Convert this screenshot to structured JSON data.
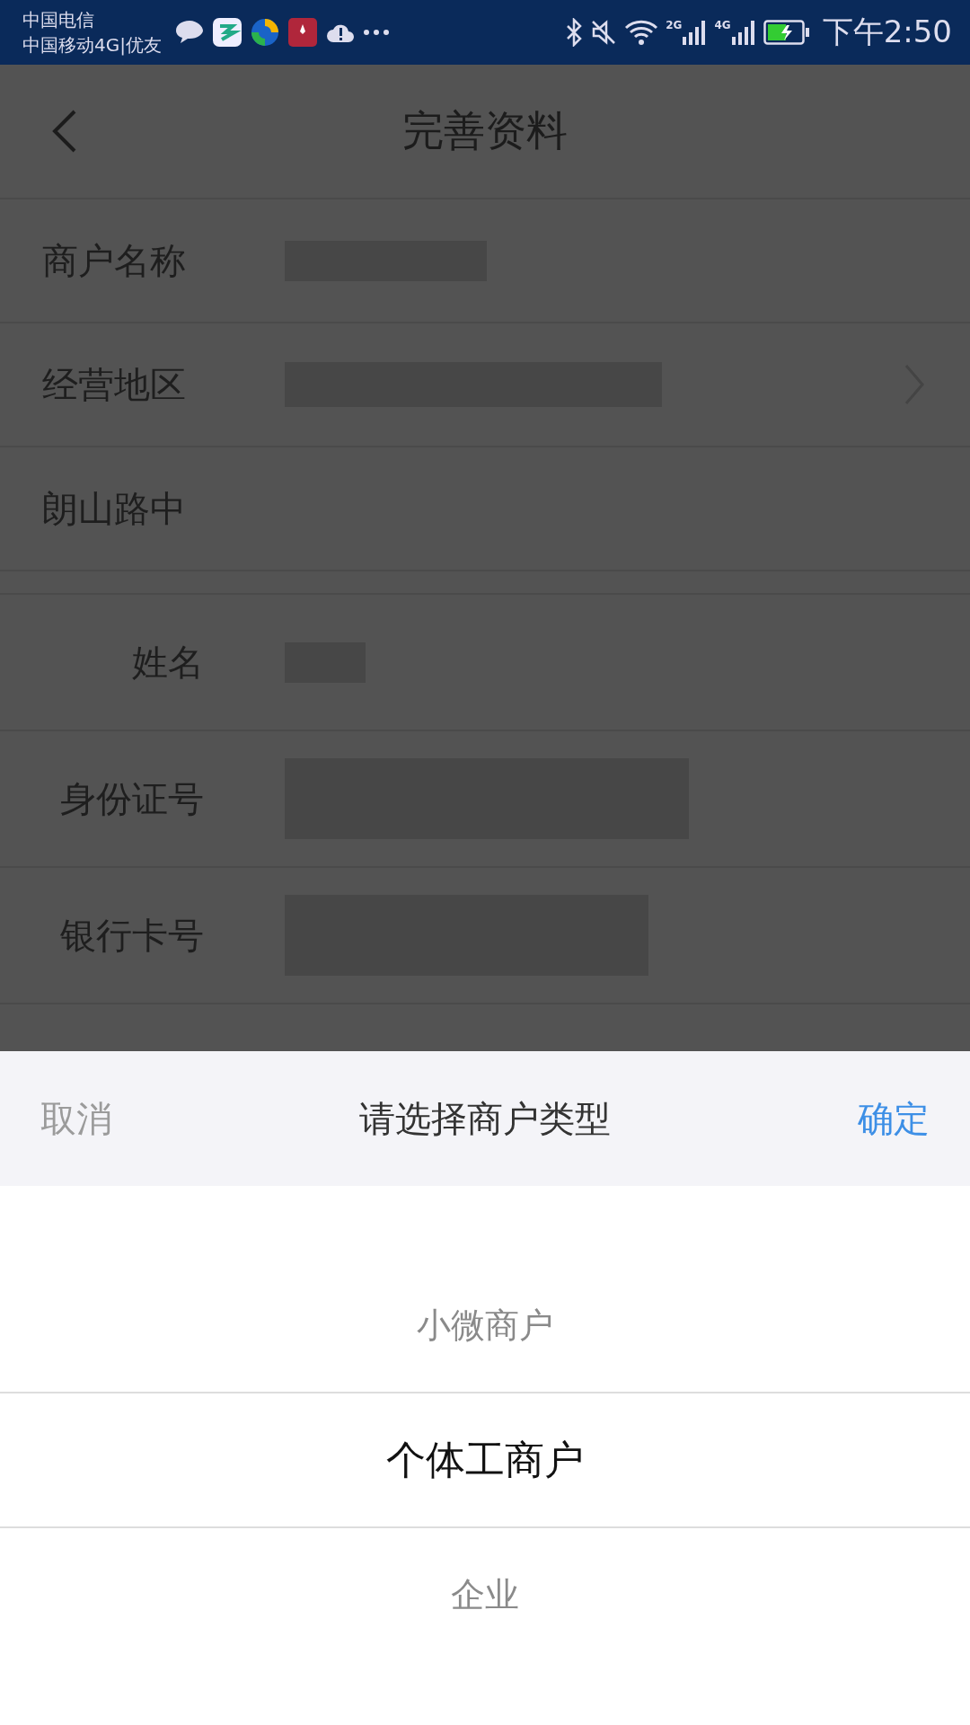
{
  "status_bar": {
    "carriers": [
      "中国电信",
      "中国移动4G|优友"
    ],
    "network_labels": [
      "2G",
      "4G"
    ],
    "time": "下午2:50"
  },
  "header": {
    "title": "完善资料"
  },
  "sections": [
    {
      "rows": [
        {
          "label": "商户名称",
          "masked": true,
          "chevron": false
        },
        {
          "label": "经营地区",
          "masked": true,
          "chevron": true
        },
        {
          "label": "朗山路中",
          "masked": false,
          "chevron": false
        }
      ]
    },
    {
      "rows": [
        {
          "label": "姓名",
          "masked": true,
          "chevron": false
        },
        {
          "label": "身份证号",
          "masked": true,
          "chevron": false
        },
        {
          "label": "银行卡号",
          "masked": true,
          "chevron": false
        }
      ]
    }
  ],
  "picker": {
    "cancel": "取消",
    "title": "请选择商户类型",
    "confirm": "确定",
    "options": [
      {
        "label": "小微商户",
        "selected": false
      },
      {
        "label": "个体工商户",
        "selected": true
      },
      {
        "label": "企业",
        "selected": false
      }
    ]
  }
}
